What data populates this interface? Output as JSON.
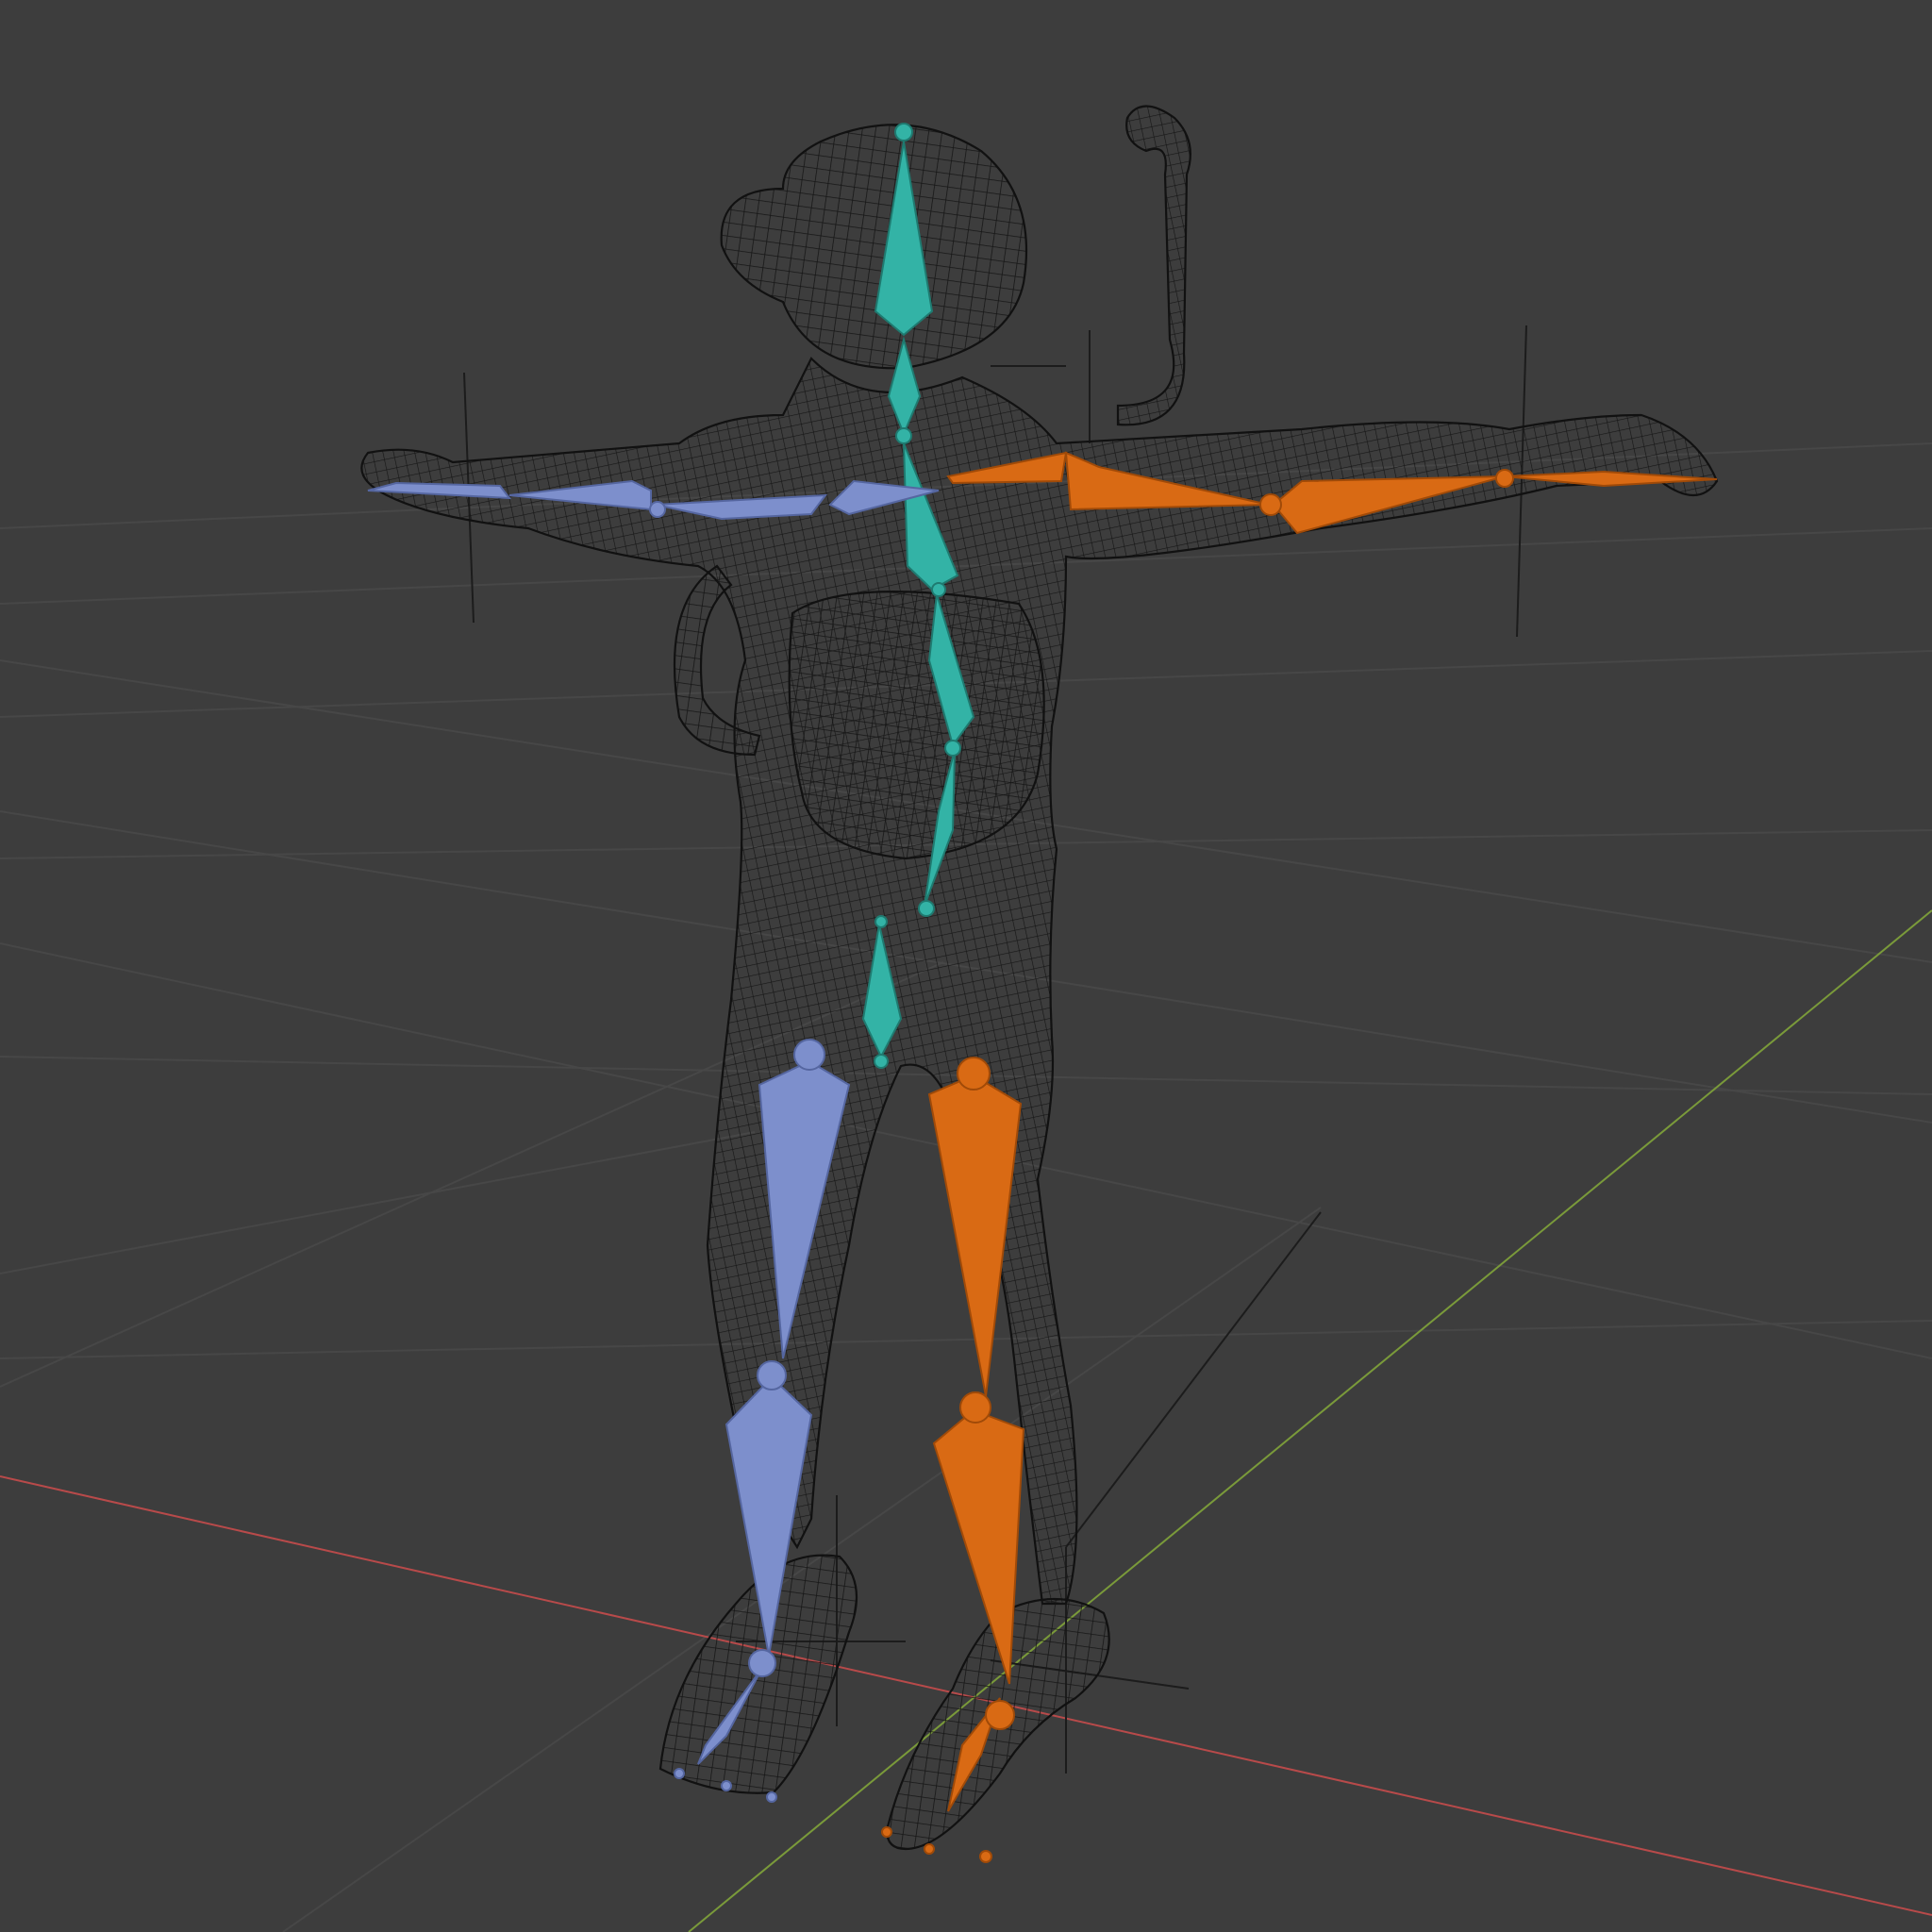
{
  "viewport": {
    "background": "#3d3d3d",
    "grid_color": "#4a4a4a",
    "x_axis_color": "#b84a4a",
    "y_axis_color": "#7a9a3a"
  },
  "mesh": {
    "style": "wireframe",
    "wire_color": "#161616"
  },
  "armature": {
    "center_color": "#33b3a6",
    "left_color": "#7d8fcc",
    "right_color": "#d96a14",
    "bones": {
      "center": [
        "head",
        "neck",
        "chest",
        "spine-upper",
        "spine-mid",
        "spine-lower",
        "hips"
      ],
      "left": [
        "upper-arm-left",
        "forearm-left",
        "hand-left",
        "thigh-left",
        "shin-left",
        "foot-left"
      ],
      "right": [
        "upper-arm-right",
        "forearm-right",
        "hand-right",
        "thigh-right",
        "shin-right",
        "foot-right"
      ]
    }
  }
}
